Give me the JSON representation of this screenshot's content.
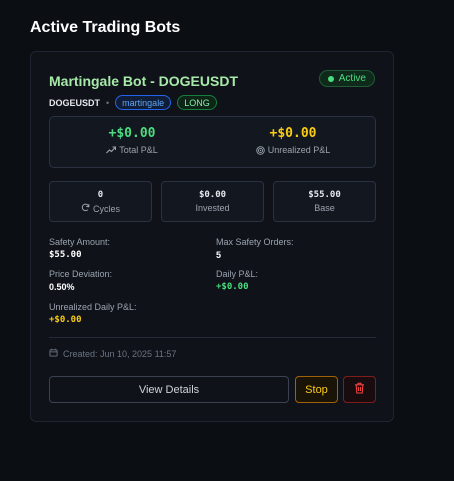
{
  "page": {
    "title": "Active Trading Bots"
  },
  "bot": {
    "name": "Martingale Bot - DOGEUSDT",
    "status": "Active",
    "symbol": "DOGEUSDT",
    "separator": "•",
    "strategy": "martingale",
    "side": "LONG",
    "total_pnl": {
      "value": "+$0.00",
      "label": "Total P&L",
      "icon": "trending-up-icon"
    },
    "unrealized_pnl": {
      "value": "+$0.00",
      "label": "Unrealized P&L",
      "icon": "target-icon"
    },
    "stats": {
      "cycles": {
        "value": "0",
        "label": "Cycles",
        "icon": "refresh-icon"
      },
      "invested": {
        "value": "$0.00",
        "label": "Invested"
      },
      "base": {
        "value": "$55.00",
        "label": "Base"
      }
    },
    "details": {
      "safety_amount": {
        "label": "Safety Amount:",
        "value": "$55.00"
      },
      "max_safety_orders": {
        "label": "Max Safety Orders:",
        "value": "5"
      },
      "price_deviation": {
        "label": "Price Deviation:",
        "value": "0.50%"
      },
      "daily_pnl": {
        "label": "Daily P&L:",
        "value": "+$0.00"
      },
      "unrealized_daily_pnl": {
        "label": "Unrealized Daily P&L:",
        "value": "+$0.00"
      }
    },
    "created": "Created: Jun 10, 2025 11:57",
    "actions": {
      "view_details": "View Details",
      "stop": "Stop",
      "delete_icon": "trash-icon"
    }
  },
  "colors": {
    "accent_green": "#4ade80",
    "accent_yellow": "#facc15",
    "accent_blue": "#60a5fa",
    "danger_red": "#ef4444",
    "title_green": "#a7e9a9"
  }
}
